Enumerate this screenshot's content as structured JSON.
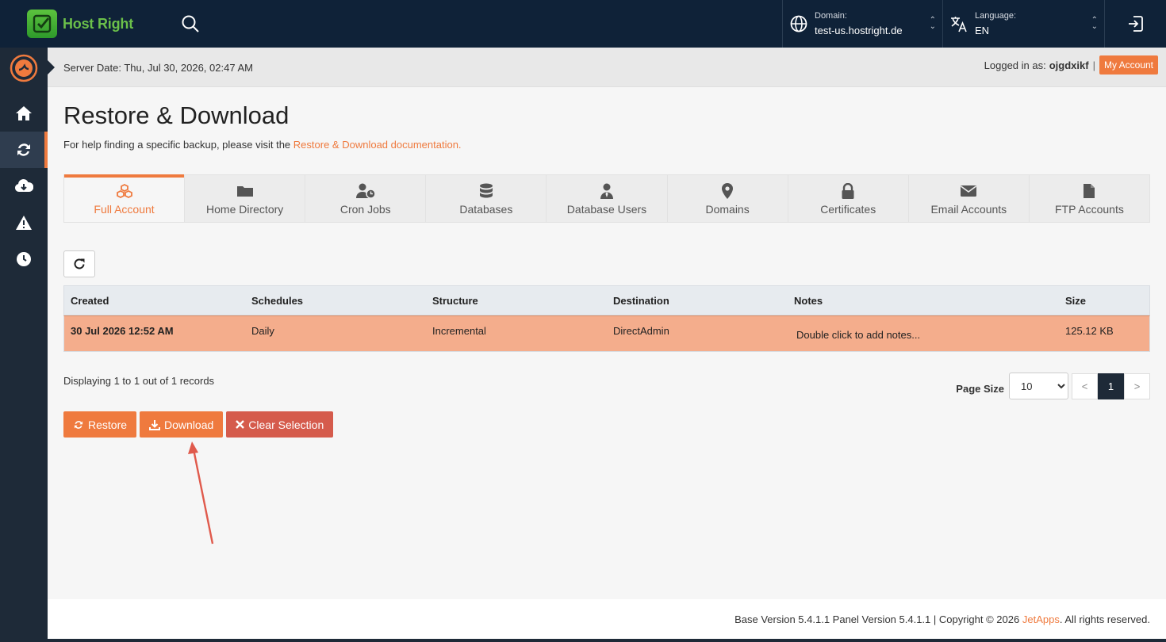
{
  "brand": {
    "name": "Host Right"
  },
  "topbar": {
    "domain": {
      "label": "Domain:",
      "value": "test-us.hostright.de"
    },
    "language": {
      "label": "Language:",
      "value": "EN"
    }
  },
  "sidebar": {
    "items": [
      {
        "icon": "home-icon"
      },
      {
        "icon": "sync-icon",
        "active": true
      },
      {
        "icon": "cloud-download-icon"
      },
      {
        "icon": "warning-icon"
      },
      {
        "icon": "clock-icon"
      }
    ]
  },
  "header": {
    "server_date": "Server Date: Thu, Jul 30, 2026, 02:47 AM",
    "logged_in_prefix": "Logged in as:",
    "username": "ojgdxikf",
    "separator": "|",
    "my_account": "My Account"
  },
  "page": {
    "title": "Restore & Download",
    "help_prefix": "For help finding a specific backup, please visit the",
    "help_link": "Restore & Download documentation."
  },
  "tabs": [
    {
      "label": "Full Account",
      "icon": "cubes-icon",
      "active": true
    },
    {
      "label": "Home Directory",
      "icon": "folder-icon"
    },
    {
      "label": "Cron Jobs",
      "icon": "user-clock-icon"
    },
    {
      "label": "Databases",
      "icon": "database-icon"
    },
    {
      "label": "Database Users",
      "icon": "user-tie-icon"
    },
    {
      "label": "Domains",
      "icon": "map-marker-icon"
    },
    {
      "label": "Certificates",
      "icon": "lock-icon"
    },
    {
      "label": "Email Accounts",
      "icon": "envelope-icon"
    },
    {
      "label": "FTP Accounts",
      "icon": "file-icon"
    }
  ],
  "table": {
    "columns": [
      "Created",
      "Schedules",
      "Structure",
      "Destination",
      "Notes",
      "Size"
    ],
    "rows": [
      {
        "created": "30 Jul 2026 12:52 AM",
        "schedules": "Daily",
        "structure": "Incremental",
        "destination": "DirectAdmin",
        "notes": "Double click to add notes...",
        "size": "125.12 KB"
      }
    ]
  },
  "pagination": {
    "records": "Displaying 1 to 1 out of 1 records",
    "page_size_label": "Page Size",
    "page_size": "10",
    "prev": "<",
    "current": "1",
    "next": ">"
  },
  "actions": {
    "restore": "Restore",
    "download": "Download",
    "clear": "Clear Selection"
  },
  "footer": {
    "text": "Base Version 5.4.1.1 Panel Version 5.4.1.1 | Copyright © 2026",
    "link": "JetApps",
    "suffix": ". All rights reserved."
  },
  "colors": {
    "accent": "#ef7a3e",
    "navy": "#0f2238",
    "sidebar": "#1e2a38",
    "selected_row": "#f4ad8c",
    "danger": "#d55b4c"
  }
}
